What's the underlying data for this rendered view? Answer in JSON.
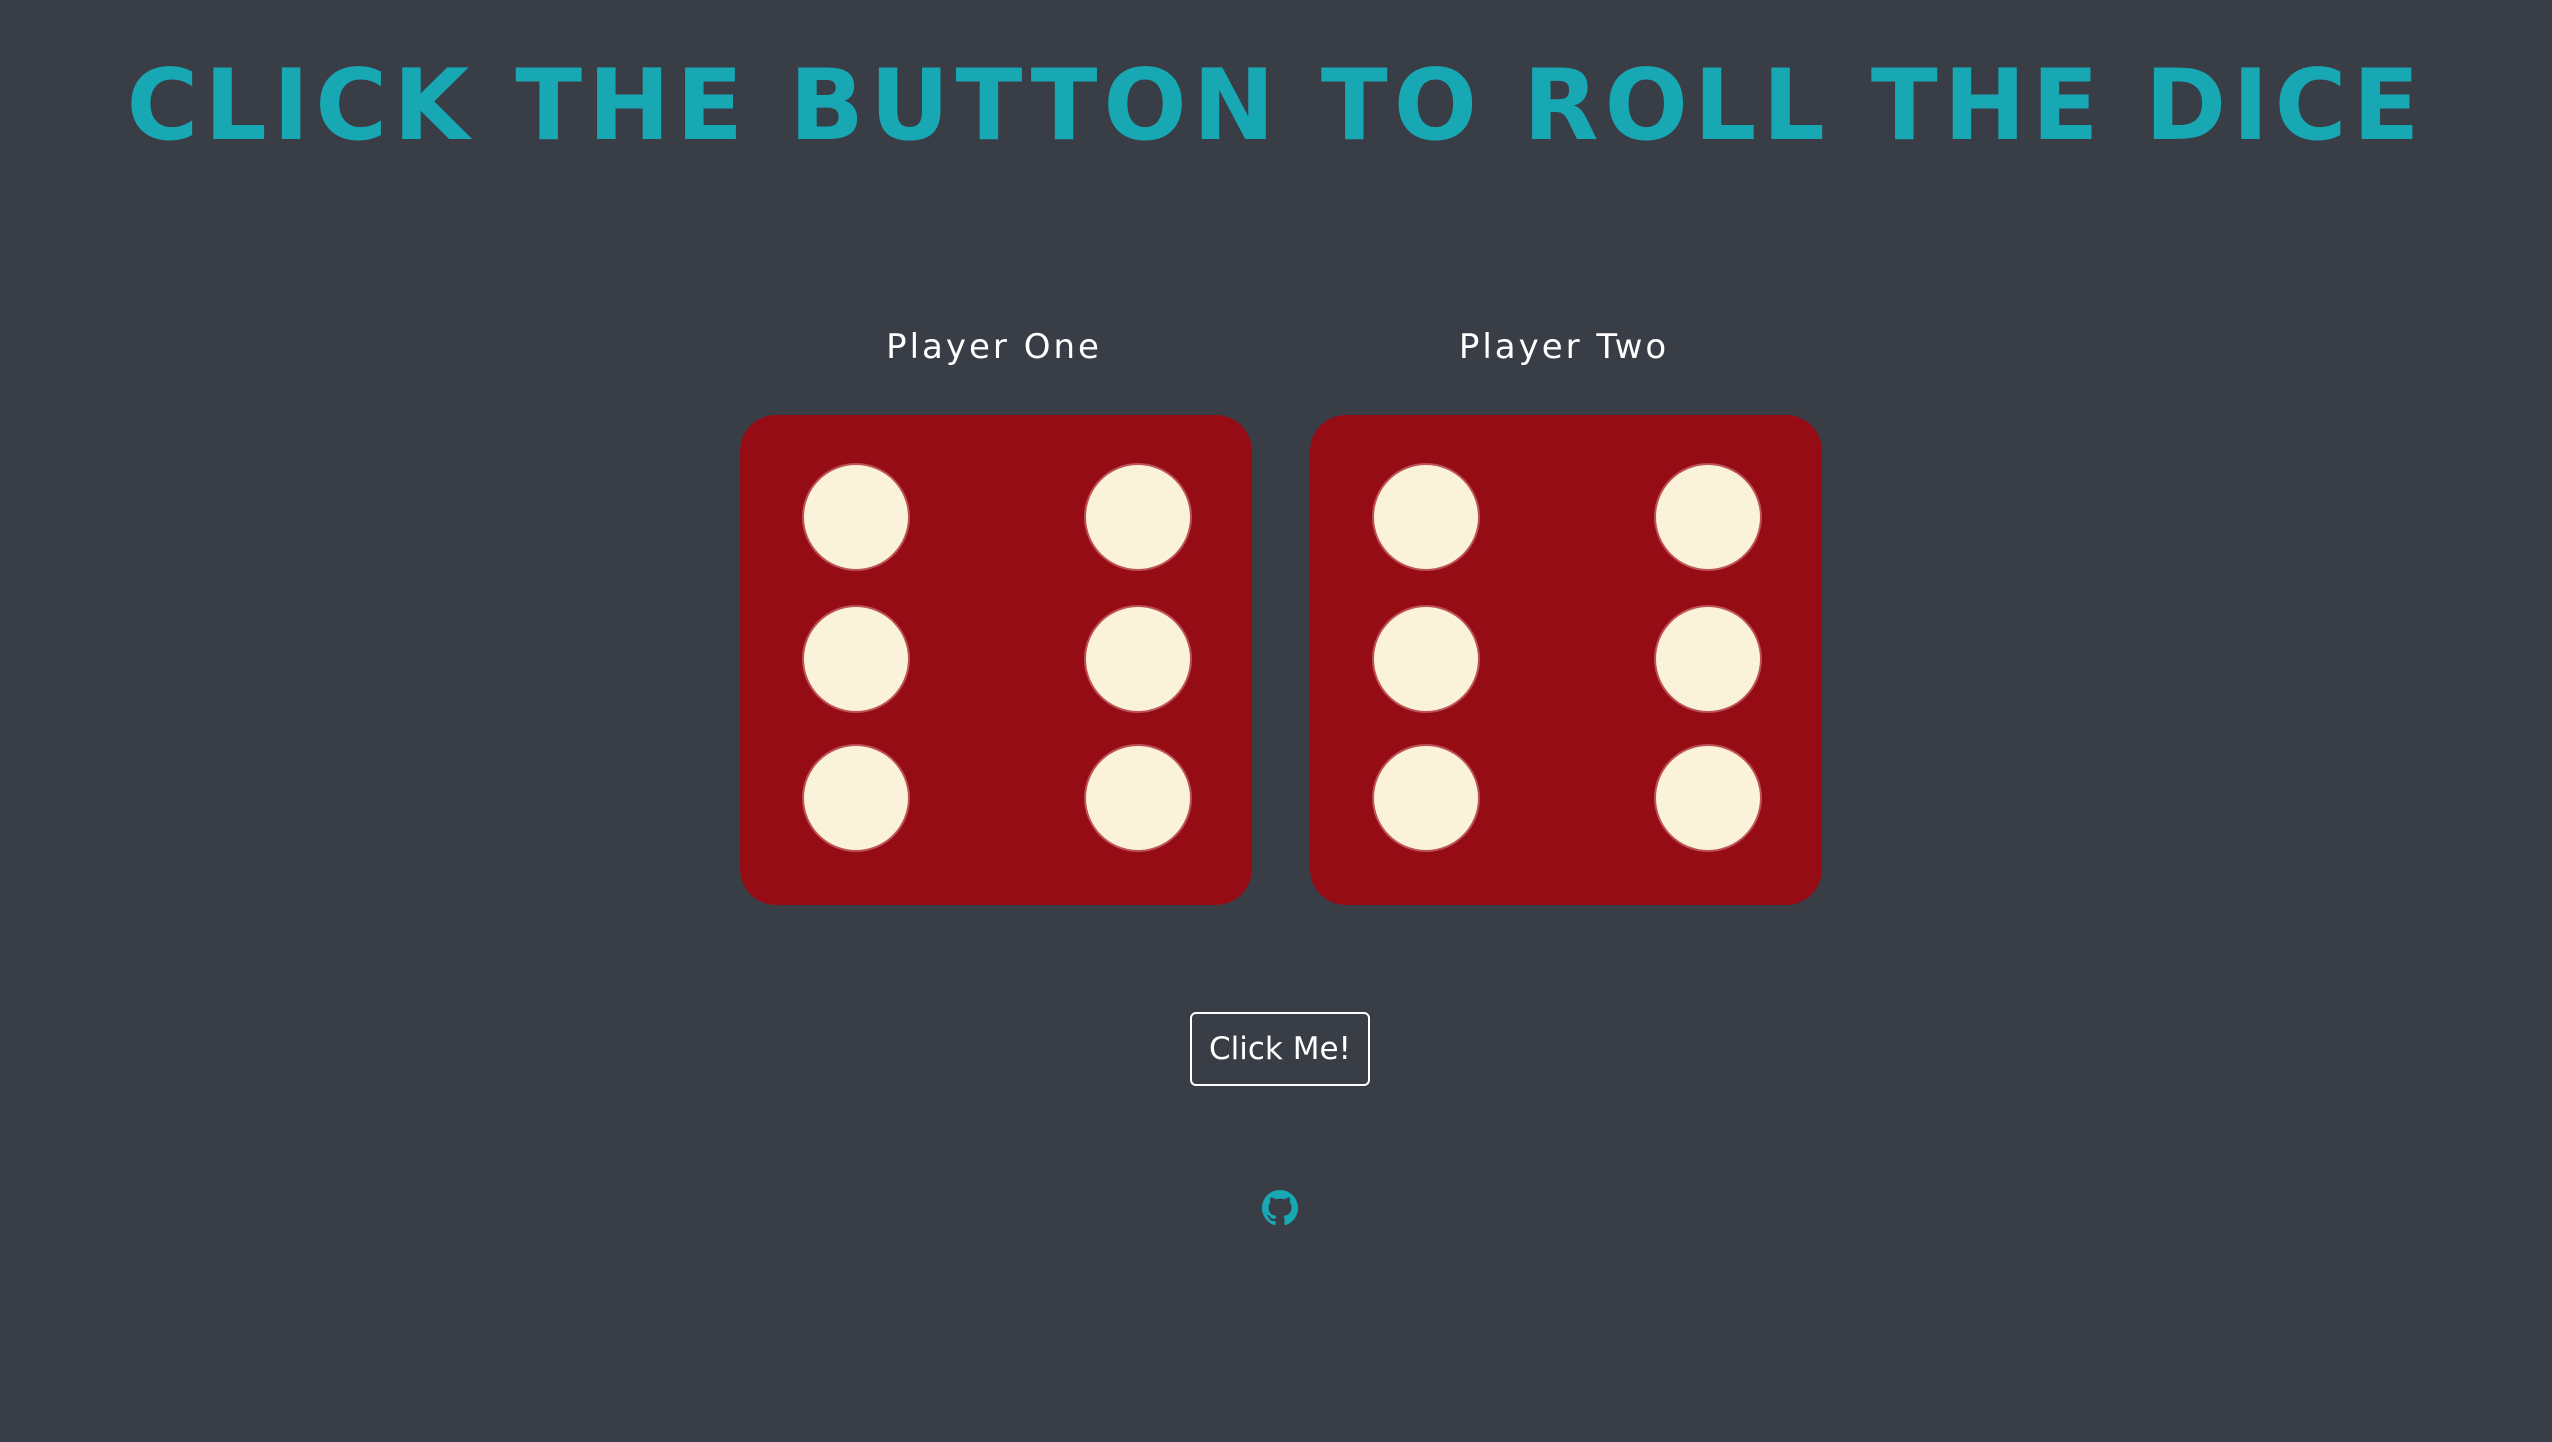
{
  "header": {
    "title": "CLICK THE BUTTON TO ROLL THE DICE"
  },
  "players": [
    {
      "label": "Player One",
      "die_value": 6
    },
    {
      "label": "Player Two",
      "die_value": 6
    }
  ],
  "roll_button": {
    "label": "Click Me!"
  },
  "footer": {
    "icon": "github-icon"
  },
  "colors": {
    "background": "#393e46",
    "title": "#18a8b4",
    "die": "#960c15",
    "pip": "#faf2d9",
    "text": "#ffffff",
    "icon": "#18a8b4"
  }
}
